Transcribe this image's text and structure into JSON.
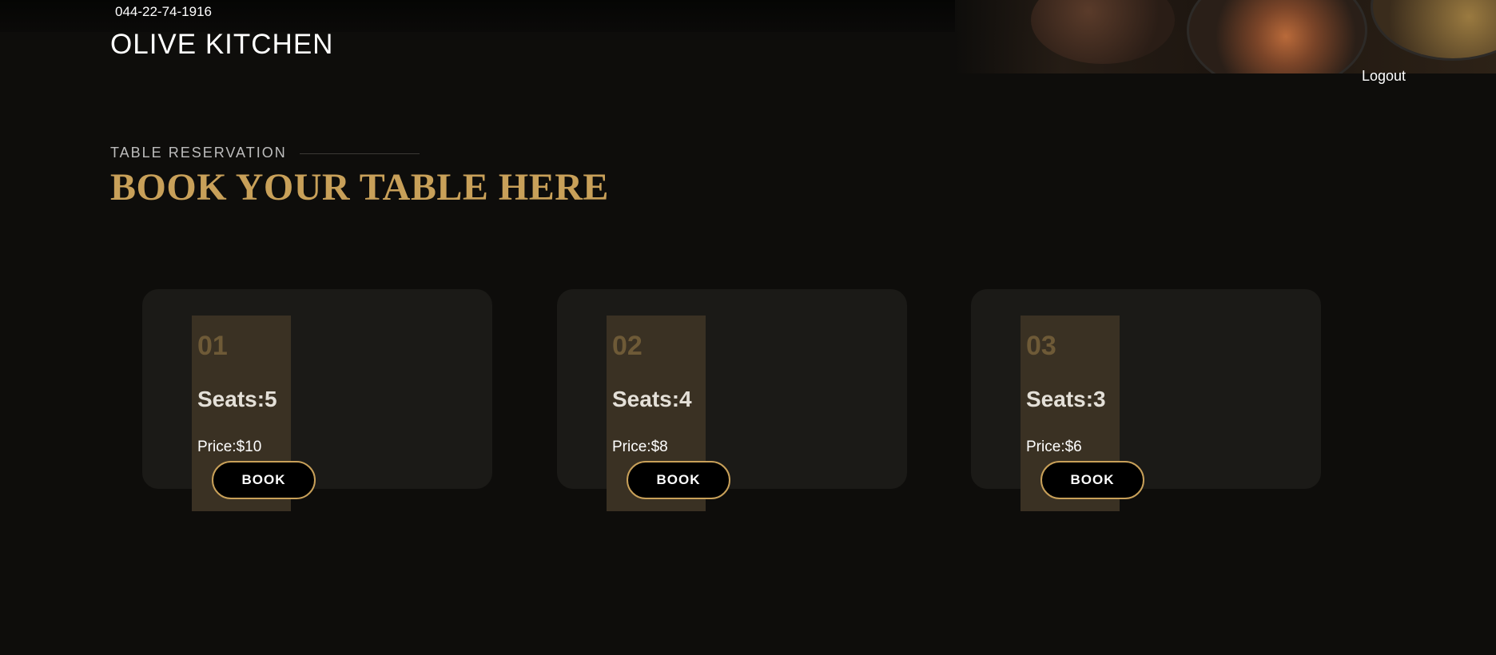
{
  "topbar": {
    "phone": "044-22-74-1916"
  },
  "header": {
    "brand": "OLIVE KITCHEN",
    "logout_label": "Logout"
  },
  "section": {
    "eyebrow": "TABLE RESERVATION",
    "headline": "BOOK YOUR TABLE HERE"
  },
  "tables": [
    {
      "number": "01",
      "seats": "Seats:5",
      "price": "Price:$10",
      "button_label": "BOOK"
    },
    {
      "number": "02",
      "seats": "Seats:4",
      "price": "Price:$8",
      "button_label": "BOOK"
    },
    {
      "number": "03",
      "seats": "Seats:3",
      "price": "Price:$6",
      "button_label": "BOOK"
    }
  ],
  "colors": {
    "background": "#0e0d0b",
    "accent_gold": "#c8a059",
    "card": "#1b1a17",
    "stripe": "#3a3123"
  }
}
